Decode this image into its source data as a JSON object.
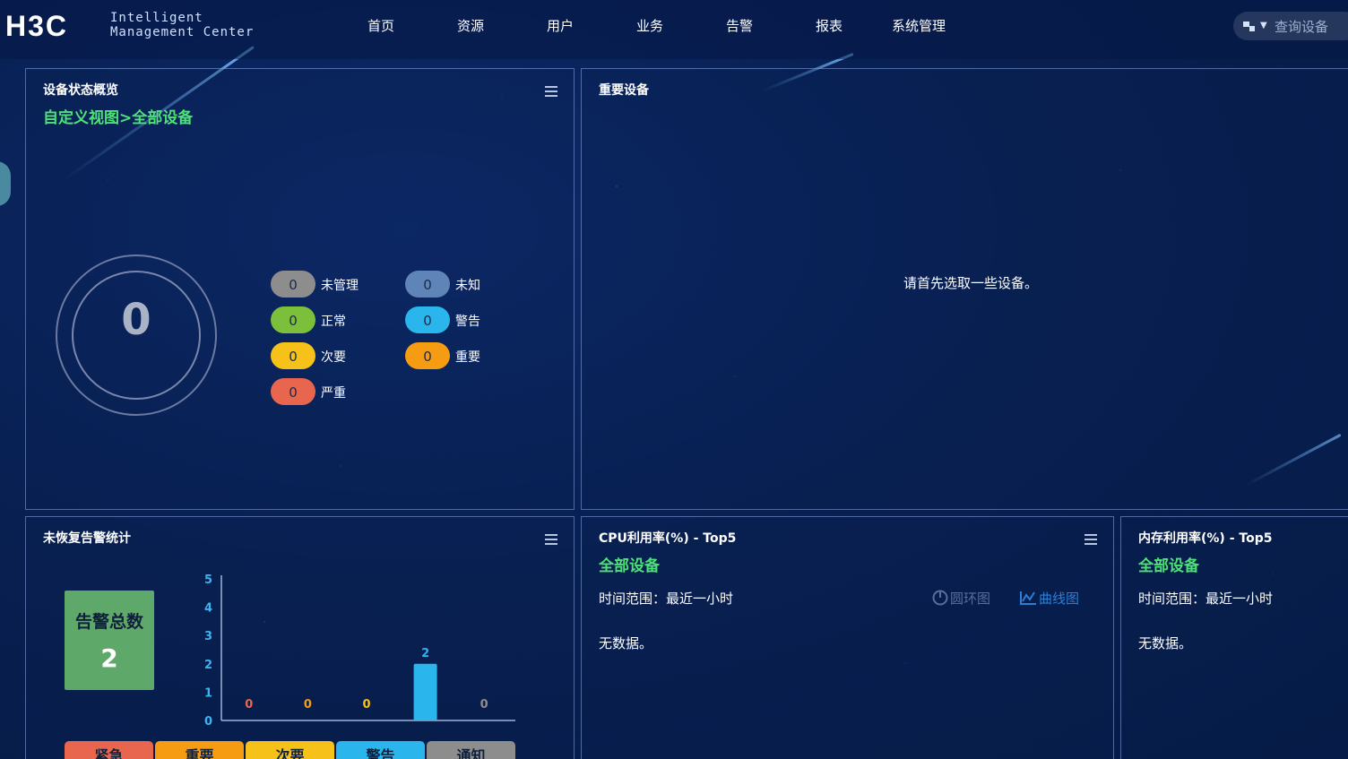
{
  "header": {
    "logo_text": "H3C",
    "logo_sub_line1": "Intelligent",
    "logo_sub_line2": "Management Center",
    "nav": [
      "首页",
      "资源",
      "用户",
      "业务",
      "告警",
      "报表",
      "系统管理"
    ],
    "search_placeholder": "查询设备"
  },
  "status_panel": {
    "title": "设备状态概览",
    "subtitle": "自定义视图>全部设备",
    "total": "0",
    "items": [
      {
        "count": "0",
        "label": "未管理",
        "color": "#8d8d8d"
      },
      {
        "count": "0",
        "label": "未知",
        "color": "#5f85b8"
      },
      {
        "count": "0",
        "label": "正常",
        "color": "#7cbf3a"
      },
      {
        "count": "0",
        "label": "警告",
        "color": "#2ab6ec"
      },
      {
        "count": "0",
        "label": "次要",
        "color": "#f6c219"
      },
      {
        "count": "0",
        "label": "重要",
        "color": "#f59c12"
      },
      {
        "count": "0",
        "label": "严重",
        "color": "#e8654e"
      }
    ]
  },
  "important_panel": {
    "title": "重要设备",
    "message": "请首先选取一些设备。"
  },
  "alarm_panel": {
    "title": "未恢复告警统计",
    "total_label": "告警总数",
    "total_value": "2",
    "chart_data": {
      "type": "bar",
      "categories": [
        "紧急",
        "重要",
        "次要",
        "警告",
        "通知"
      ],
      "values": [
        0,
        0,
        0,
        2,
        0
      ],
      "ylim": [
        0,
        5
      ],
      "yticks": [
        0,
        1,
        2,
        3,
        4,
        5
      ],
      "value_label_colors": [
        "#e8654e",
        "#f59c12",
        "#f6c219",
        "#2ab6ec",
        "#8d8d8d"
      ],
      "bar_color": "#2ab6ec"
    },
    "tabs": [
      {
        "label": "紧急",
        "color": "#e8654e"
      },
      {
        "label": "重要",
        "color": "#f59c12"
      },
      {
        "label": "次要",
        "color": "#f6c219"
      },
      {
        "label": "警告",
        "color": "#2ab6ec"
      },
      {
        "label": "通知",
        "color": "#8d8d8d"
      }
    ]
  },
  "cpu_panel": {
    "title": "CPU利用率(%) - Top5",
    "subtitle": "全部设备",
    "time_range": "时间范围：最近一小时",
    "ring_view_label": "圆环图",
    "curve_view_label": "曲线图",
    "no_data": "无数据。"
  },
  "mem_panel": {
    "title": "内存利用率(%) - Top5",
    "subtitle": "全部设备",
    "time_range": "时间范围：最近一小时",
    "no_data": "无数据。"
  },
  "colors": {
    "accent_green": "#4fe07a",
    "link_blue": "#2a7fd6"
  }
}
